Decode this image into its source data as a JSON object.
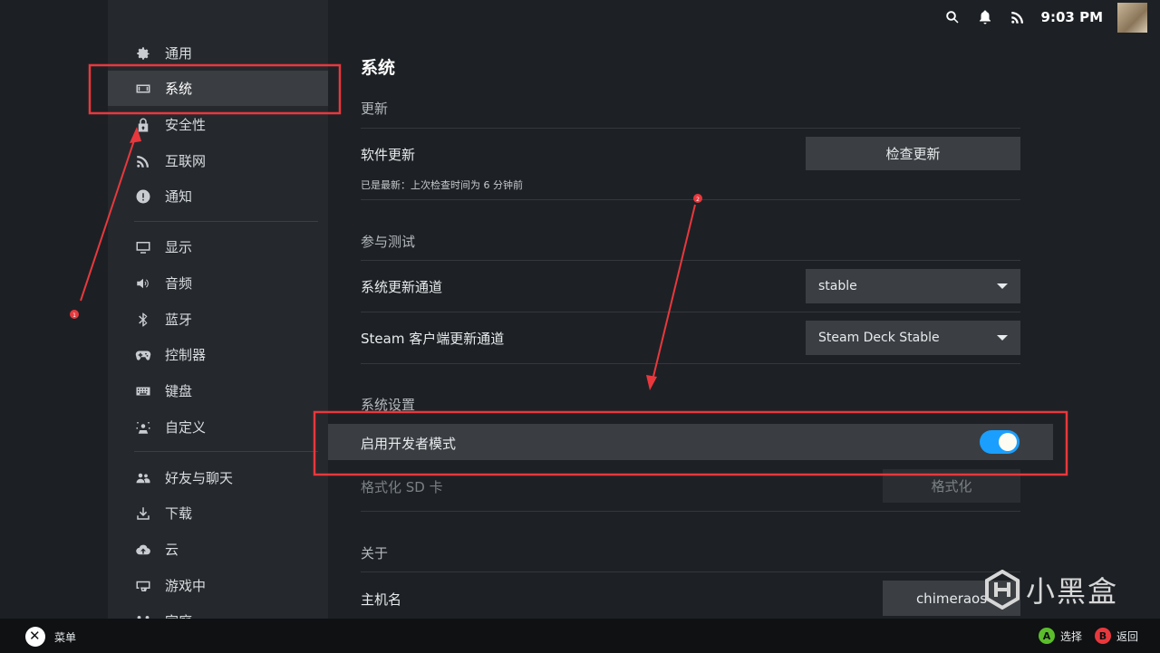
{
  "sidebar": {
    "items": [
      {
        "label": "通用",
        "icon": "gear-icon"
      },
      {
        "label": "系统",
        "icon": "system-icon"
      },
      {
        "label": "安全性",
        "icon": "lock-icon"
      },
      {
        "label": "互联网",
        "icon": "wifi-icon"
      },
      {
        "label": "通知",
        "icon": "alert-icon"
      },
      {
        "label": "显示",
        "icon": "monitor-icon"
      },
      {
        "label": "音频",
        "icon": "speaker-icon"
      },
      {
        "label": "蓝牙",
        "icon": "bluetooth-icon"
      },
      {
        "label": "控制器",
        "icon": "gamepad-icon"
      },
      {
        "label": "键盘",
        "icon": "keyboard-icon"
      },
      {
        "label": "自定义",
        "icon": "customize-icon"
      },
      {
        "label": "好友与聊天",
        "icon": "friends-icon"
      },
      {
        "label": "下载",
        "icon": "download-icon"
      },
      {
        "label": "云",
        "icon": "cloud-icon"
      },
      {
        "label": "游戏中",
        "icon": "ingame-icon"
      },
      {
        "label": "家庭",
        "icon": "family-icon"
      }
    ],
    "active_index": 1
  },
  "topbar": {
    "time": "9:03 PM",
    "icons": [
      "search-icon",
      "bell-icon",
      "network-icon"
    ]
  },
  "main": {
    "title": "系统",
    "update": {
      "section": "更新",
      "label": "软件更新",
      "status": "已是最新：上次检查时间为 6 分钟前",
      "button": "检查更新"
    },
    "beta": {
      "section": "参与测试",
      "os_label": "系统更新通道",
      "os_value": "stable",
      "client_label": "Steam 客户端更新通道",
      "client_value": "Steam Deck Stable"
    },
    "system_settings": {
      "section": "系统设置",
      "dev_mode_label": "启用开发者模式",
      "dev_mode_on": true,
      "format_label": "格式化 SD 卡",
      "format_button": "格式化"
    },
    "about": {
      "section": "关于",
      "hostname_label": "主机名",
      "hostname_value": "chimeraos"
    }
  },
  "bottombar": {
    "menu_label": "菜单",
    "select_key": "A",
    "select_label": "选择",
    "back_key": "B",
    "back_label": "返回"
  },
  "watermark": {
    "text": "小黑盒"
  },
  "annotations": {
    "marker_1": "1",
    "marker_2": "2",
    "color": "#e8383d"
  },
  "colors": {
    "accent": "#1a9fff",
    "btn_a": "#5bbd2b",
    "btn_b": "#e8383d"
  }
}
